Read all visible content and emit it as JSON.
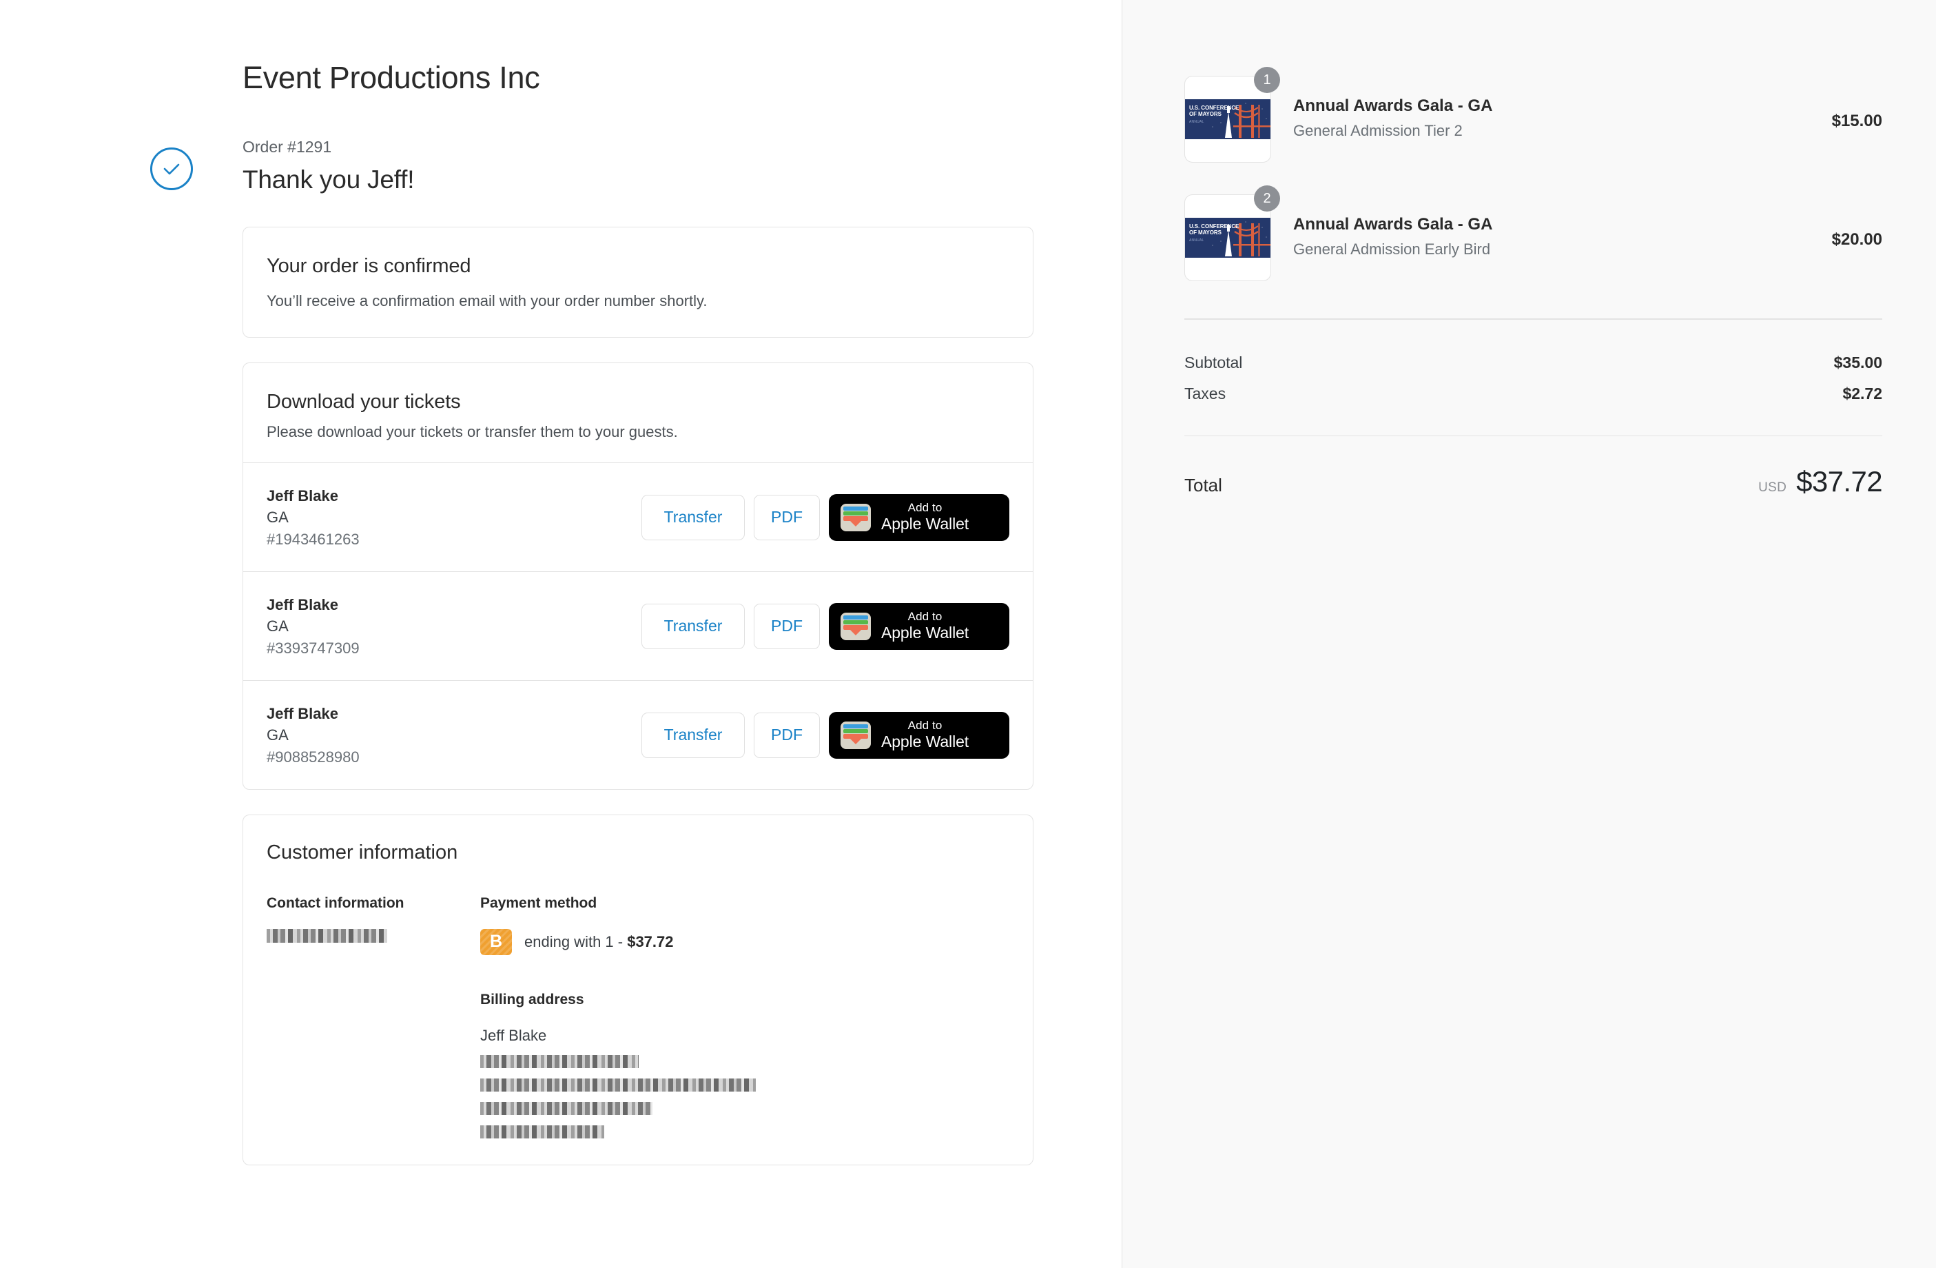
{
  "merchant": {
    "name": "Event Productions Inc"
  },
  "order": {
    "number_label": "Order #1291",
    "thank_you": "Thank you Jeff!",
    "check_icon": "check-circle-icon",
    "accent_color": "#1a82c7"
  },
  "confirmation_card": {
    "title": "Your order is confirmed",
    "subtitle": "You’ll receive a confirmation email with your order number shortly."
  },
  "tickets_card": {
    "title": "Download your tickets",
    "subtitle": "Please download your tickets or transfer them to your guests.",
    "transfer_label": "Transfer",
    "pdf_label": "PDF",
    "wallet_top_label": "Add to",
    "wallet_bottom_label": "Apple Wallet",
    "wallet_icon": "apple-wallet-icon",
    "rows": [
      {
        "name": "Jeff Blake",
        "tier": "GA",
        "serial": "#1943461263"
      },
      {
        "name": "Jeff Blake",
        "tier": "GA",
        "serial": "#3393747309"
      },
      {
        "name": "Jeff Blake",
        "tier": "GA",
        "serial": "#9088528980"
      }
    ]
  },
  "customer_card": {
    "title": "Customer information",
    "contact_heading": "Contact information",
    "contact_value_redacted": true,
    "payment_heading": "Payment method",
    "payment_badge_letter": "B",
    "payment_badge_color": "#f0a030",
    "payment_text": "ending with 1 - ",
    "payment_amount": "$37.72",
    "billing_heading": "Billing address",
    "billing_name": "Jeff Blake",
    "billing_lines_redacted": [
      230,
      400,
      250,
      180
    ]
  },
  "summary": {
    "items": [
      {
        "qty": "1",
        "title": "Annual Awards Gala - GA",
        "subtitle": "General Admission Tier 2",
        "price": "$15.00",
        "thumb_label_line1": "U.S. CONFERENCE",
        "thumb_label_line2": "OF MAYORS",
        "thumb_sub": "ANNUAL",
        "thumb_icon": "golden-gate-bridge-thumbnail"
      },
      {
        "qty": "2",
        "title": "Annual Awards Gala - GA",
        "subtitle": "General Admission Early Bird",
        "price": "$20.00",
        "thumb_label_line1": "U.S. CONFERENCE",
        "thumb_label_line2": "OF MAYORS",
        "thumb_sub": "ANNUAL",
        "thumb_icon": "golden-gate-bridge-thumbnail"
      }
    ],
    "subtotal_label": "Subtotal",
    "subtotal_value": "$35.00",
    "taxes_label": "Taxes",
    "taxes_value": "$2.72",
    "total_label": "Total",
    "total_currency": "USD",
    "total_value": "$37.72"
  }
}
